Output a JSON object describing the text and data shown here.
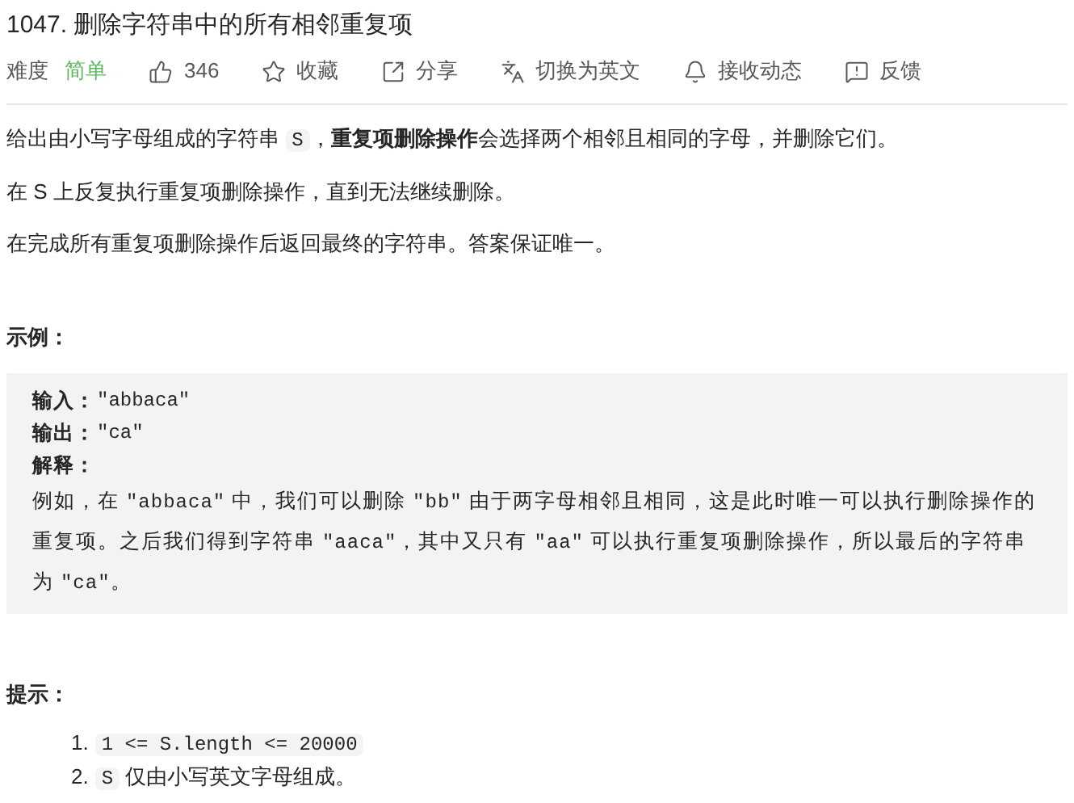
{
  "title": "1047. 删除字符串中的所有相邻重复项",
  "meta": {
    "difficulty_label": "难度",
    "difficulty": "简单",
    "actions": [
      {
        "kind": "like",
        "label": "346"
      },
      {
        "kind": "favorite",
        "label": "收藏"
      },
      {
        "kind": "share",
        "label": "分享"
      },
      {
        "kind": "translate",
        "label": "切换为英文"
      },
      {
        "kind": "subscribe",
        "label": "接收动态"
      },
      {
        "kind": "feedback",
        "label": "反馈"
      }
    ]
  },
  "description": [
    [
      {
        "kind": "text",
        "text": "给出由小写字母组成的字符串 "
      },
      {
        "kind": "code",
        "text": "S"
      },
      {
        "kind": "text",
        "text": "，"
      },
      {
        "kind": "bold",
        "text": "重复项删除操作"
      },
      {
        "kind": "text",
        "text": "会选择两个相邻且相同的字母，并删除它们。"
      }
    ],
    [
      {
        "kind": "text",
        "text": "在 S 上反复执行重复项删除操作，直到无法继续删除。"
      }
    ],
    [
      {
        "kind": "text",
        "text": "在完成所有重复项删除操作后返回最终的字符串。答案保证唯一。"
      }
    ]
  ],
  "example": {
    "heading": "示例：",
    "lines": [
      {
        "label": "输入：",
        "value": "\"abbaca\""
      },
      {
        "label": "输出：",
        "value": "\"ca\""
      },
      {
        "label": "解释："
      }
    ],
    "explanation": [
      {
        "kind": "text",
        "text": "例如，在 "
      },
      {
        "kind": "mono",
        "text": "\"abbaca\""
      },
      {
        "kind": "text",
        "text": " 中，我们可以删除 "
      },
      {
        "kind": "mono",
        "text": "\"bb\""
      },
      {
        "kind": "text",
        "text": " 由于两字母相邻且相同，这是此时唯一可以执行删除操作的重复项。之后我们得到字符串 "
      },
      {
        "kind": "mono",
        "text": "\"aaca\""
      },
      {
        "kind": "text",
        "text": "，其中又只有 "
      },
      {
        "kind": "mono",
        "text": "\"aa\""
      },
      {
        "kind": "text",
        "text": " 可以执行重复项删除操作，所以最后的字符串为 "
      },
      {
        "kind": "mono",
        "text": "\"ca\""
      },
      {
        "kind": "text",
        "text": "。"
      }
    ]
  },
  "hints": {
    "heading": "提示：",
    "items": [
      {
        "number": "1.",
        "parts": [
          {
            "kind": "code",
            "text": "1 <= S.length <= 20000"
          }
        ]
      },
      {
        "number": "2.",
        "parts": [
          {
            "kind": "code",
            "text": "S"
          },
          {
            "kind": "text",
            "text": " 仅由小写英文字母组成。"
          }
        ]
      }
    ]
  }
}
